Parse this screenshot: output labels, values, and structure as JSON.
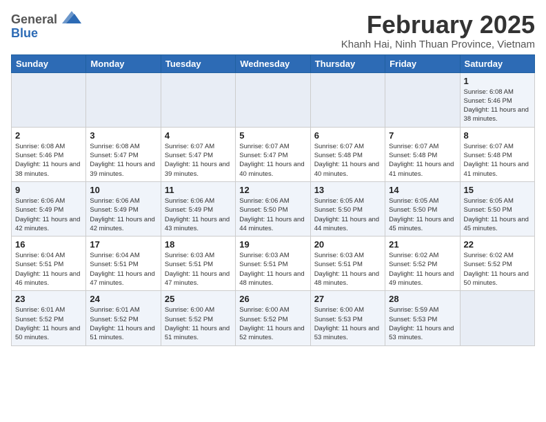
{
  "header": {
    "logo": {
      "general": "General",
      "blue": "Blue"
    },
    "title": "February 2025",
    "location": "Khanh Hai, Ninh Thuan Province, Vietnam"
  },
  "weekdays": [
    "Sunday",
    "Monday",
    "Tuesday",
    "Wednesday",
    "Thursday",
    "Friday",
    "Saturday"
  ],
  "weeks": [
    [
      {
        "day": "",
        "empty": true
      },
      {
        "day": "",
        "empty": true
      },
      {
        "day": "",
        "empty": true
      },
      {
        "day": "",
        "empty": true
      },
      {
        "day": "",
        "empty": true
      },
      {
        "day": "",
        "empty": true
      },
      {
        "day": "1",
        "sunrise": "6:08 AM",
        "sunset": "5:46 PM",
        "daylight": "11 hours and 38 minutes."
      }
    ],
    [
      {
        "day": "2",
        "sunrise": "6:08 AM",
        "sunset": "5:46 PM",
        "daylight": "11 hours and 38 minutes."
      },
      {
        "day": "3",
        "sunrise": "6:08 AM",
        "sunset": "5:47 PM",
        "daylight": "11 hours and 39 minutes."
      },
      {
        "day": "4",
        "sunrise": "6:07 AM",
        "sunset": "5:47 PM",
        "daylight": "11 hours and 39 minutes."
      },
      {
        "day": "5",
        "sunrise": "6:07 AM",
        "sunset": "5:47 PM",
        "daylight": "11 hours and 40 minutes."
      },
      {
        "day": "6",
        "sunrise": "6:07 AM",
        "sunset": "5:48 PM",
        "daylight": "11 hours and 40 minutes."
      },
      {
        "day": "7",
        "sunrise": "6:07 AM",
        "sunset": "5:48 PM",
        "daylight": "11 hours and 41 minutes."
      },
      {
        "day": "8",
        "sunrise": "6:07 AM",
        "sunset": "5:48 PM",
        "daylight": "11 hours and 41 minutes."
      }
    ],
    [
      {
        "day": "9",
        "sunrise": "6:06 AM",
        "sunset": "5:49 PM",
        "daylight": "11 hours and 42 minutes."
      },
      {
        "day": "10",
        "sunrise": "6:06 AM",
        "sunset": "5:49 PM",
        "daylight": "11 hours and 42 minutes."
      },
      {
        "day": "11",
        "sunrise": "6:06 AM",
        "sunset": "5:49 PM",
        "daylight": "11 hours and 43 minutes."
      },
      {
        "day": "12",
        "sunrise": "6:06 AM",
        "sunset": "5:50 PM",
        "daylight": "11 hours and 44 minutes."
      },
      {
        "day": "13",
        "sunrise": "6:05 AM",
        "sunset": "5:50 PM",
        "daylight": "11 hours and 44 minutes."
      },
      {
        "day": "14",
        "sunrise": "6:05 AM",
        "sunset": "5:50 PM",
        "daylight": "11 hours and 45 minutes."
      },
      {
        "day": "15",
        "sunrise": "6:05 AM",
        "sunset": "5:50 PM",
        "daylight": "11 hours and 45 minutes."
      }
    ],
    [
      {
        "day": "16",
        "sunrise": "6:04 AM",
        "sunset": "5:51 PM",
        "daylight": "11 hours and 46 minutes."
      },
      {
        "day": "17",
        "sunrise": "6:04 AM",
        "sunset": "5:51 PM",
        "daylight": "11 hours and 47 minutes."
      },
      {
        "day": "18",
        "sunrise": "6:03 AM",
        "sunset": "5:51 PM",
        "daylight": "11 hours and 47 minutes."
      },
      {
        "day": "19",
        "sunrise": "6:03 AM",
        "sunset": "5:51 PM",
        "daylight": "11 hours and 48 minutes."
      },
      {
        "day": "20",
        "sunrise": "6:03 AM",
        "sunset": "5:51 PM",
        "daylight": "11 hours and 48 minutes."
      },
      {
        "day": "21",
        "sunrise": "6:02 AM",
        "sunset": "5:52 PM",
        "daylight": "11 hours and 49 minutes."
      },
      {
        "day": "22",
        "sunrise": "6:02 AM",
        "sunset": "5:52 PM",
        "daylight": "11 hours and 50 minutes."
      }
    ],
    [
      {
        "day": "23",
        "sunrise": "6:01 AM",
        "sunset": "5:52 PM",
        "daylight": "11 hours and 50 minutes."
      },
      {
        "day": "24",
        "sunrise": "6:01 AM",
        "sunset": "5:52 PM",
        "daylight": "11 hours and 51 minutes."
      },
      {
        "day": "25",
        "sunrise": "6:00 AM",
        "sunset": "5:52 PM",
        "daylight": "11 hours and 51 minutes."
      },
      {
        "day": "26",
        "sunrise": "6:00 AM",
        "sunset": "5:52 PM",
        "daylight": "11 hours and 52 minutes."
      },
      {
        "day": "27",
        "sunrise": "6:00 AM",
        "sunset": "5:53 PM",
        "daylight": "11 hours and 53 minutes."
      },
      {
        "day": "28",
        "sunrise": "5:59 AM",
        "sunset": "5:53 PM",
        "daylight": "11 hours and 53 minutes."
      },
      {
        "day": "",
        "empty": true
      }
    ]
  ]
}
